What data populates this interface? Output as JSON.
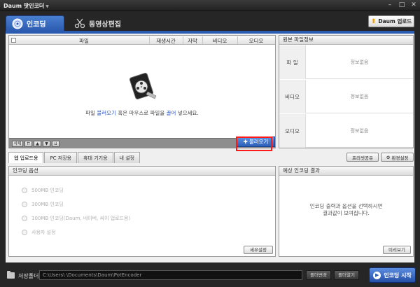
{
  "window": {
    "title": "Daum 팟인코더",
    "title_dropdown": "▼",
    "minimize": "–",
    "maximize": "□",
    "close": "✕"
  },
  "main_tabs": [
    {
      "label": "인코딩"
    },
    {
      "label": "동영상편집"
    }
  ],
  "header": {
    "upload_label": "Daum 업로드"
  },
  "file_list": {
    "columns": [
      "파일",
      "재생시간",
      "자막",
      "비디오",
      "오디오"
    ],
    "hint_prefix": "파일 ",
    "hint_import": "불러오기",
    "hint_middle": " 혹은 마우스로 파일을 ",
    "hint_drag": "끌어",
    "hint_suffix": " 넣으세요.",
    "toolbar": {
      "delete_label": "삭제",
      "top": "⇈",
      "up": "▲",
      "down": "▼",
      "bottom": "⇊"
    },
    "import_label": "불러오기"
  },
  "source_info": {
    "title": "원본 파일정보",
    "rows": [
      {
        "label": "파 일",
        "value": "정보없음"
      },
      {
        "label": "비디오",
        "value": "정보없음"
      },
      {
        "label": "오디오",
        "value": "정보없음"
      }
    ]
  },
  "sub_tabs": [
    {
      "label": "웹 업로드용"
    },
    {
      "label": "PC 저장용"
    },
    {
      "label": "휴대 기기용"
    },
    {
      "label": "내 설정"
    }
  ],
  "preset_share_label": "프리셋공유",
  "settings_label": "환경설정",
  "options": {
    "title": "인코딩 옵션",
    "items": [
      {
        "label": "500MB 인코딩"
      },
      {
        "label": "300MB 인코딩"
      },
      {
        "label": "100MB 인코딩(Daum, 네이버, 싸이 업로드용)"
      },
      {
        "label": "사용자 설정"
      }
    ],
    "detail_label": "세부설정"
  },
  "result": {
    "title": "예상 인코딩 결과",
    "message_line1": "인코딩 출력과 옵션을 선택하시면",
    "message_line2": "결과값이 보여집니다.",
    "preview_label": "미리보기"
  },
  "bottom": {
    "save_folder_label": "저장폴더",
    "path": "C:\\Users\\            \\Documents\\Daum\\PotEncoder",
    "change_folder_label": "폴더변경",
    "open_folder_label": "폴더열기",
    "start_label": "인코딩 시작"
  },
  "colors": {
    "accent": "#2b5bb0",
    "highlight": "#ff1a1a",
    "background": "#262626"
  }
}
